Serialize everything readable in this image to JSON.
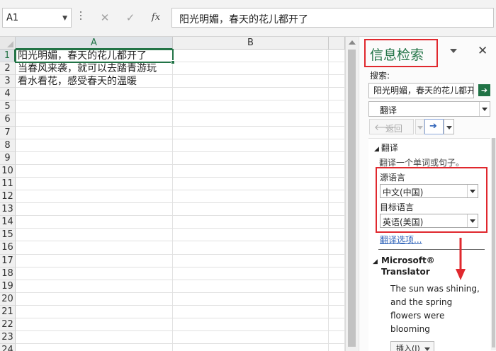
{
  "formula_bar": {
    "name_box": "A1",
    "cancel_icon": "✕",
    "enter_icon": "✓",
    "fx_label": "fx",
    "value": "阳光明媚，春天的花儿都开了"
  },
  "sheet": {
    "columns": [
      "A",
      "B"
    ],
    "rows": [
      {
        "num": "1",
        "a": "阳光明媚，春天的花儿都开了",
        "b": ""
      },
      {
        "num": "2",
        "a": "当春风来袭，就可以去踏青游玩",
        "b": ""
      },
      {
        "num": "3",
        "a": "看水看花，感受春天的温暖",
        "b": ""
      },
      {
        "num": "4",
        "a": "",
        "b": ""
      },
      {
        "num": "5",
        "a": "",
        "b": ""
      },
      {
        "num": "6",
        "a": "",
        "b": ""
      },
      {
        "num": "7",
        "a": "",
        "b": ""
      },
      {
        "num": "8",
        "a": "",
        "b": ""
      },
      {
        "num": "9",
        "a": "",
        "b": ""
      },
      {
        "num": "10",
        "a": "",
        "b": ""
      },
      {
        "num": "11",
        "a": "",
        "b": ""
      },
      {
        "num": "12",
        "a": "",
        "b": ""
      },
      {
        "num": "13",
        "a": "",
        "b": ""
      },
      {
        "num": "14",
        "a": "",
        "b": ""
      },
      {
        "num": "15",
        "a": "",
        "b": ""
      },
      {
        "num": "16",
        "a": "",
        "b": ""
      },
      {
        "num": "17",
        "a": "",
        "b": ""
      },
      {
        "num": "18",
        "a": "",
        "b": ""
      },
      {
        "num": "19",
        "a": "",
        "b": ""
      },
      {
        "num": "20",
        "a": "",
        "b": ""
      },
      {
        "num": "21",
        "a": "",
        "b": ""
      },
      {
        "num": "22",
        "a": "",
        "b": ""
      },
      {
        "num": "23",
        "a": "",
        "b": ""
      },
      {
        "num": "24",
        "a": "",
        "b": ""
      }
    ]
  },
  "pane": {
    "title": "信息检索",
    "close_icon": "✕",
    "search_label": "搜索:",
    "search_value": "阳光明媚，春天的花儿都开了",
    "go_icon": "➔",
    "service": "翻译",
    "back_icon": "🡐",
    "back_label": "返回",
    "forward_icon": "➔",
    "results": {
      "section_title": "翻译",
      "collapse_icon": "◢",
      "description": "翻译一个单词或句子。",
      "source_label": "源语言",
      "source_value": "中文(中国)",
      "target_label": "目标语言",
      "target_value": "英语(美国)",
      "options_link": "翻译选项...",
      "provider_line1": "Microsoft®",
      "provider_line2": "Translator",
      "translation_lines": [
        "The sun was shining,",
        "and the spring",
        "flowers were",
        "blooming"
      ],
      "insert_label": "插入(I)"
    }
  },
  "colors": {
    "excel_green": "#217346",
    "annotation_red": "#e0282e",
    "link_blue": "#2e62b8"
  }
}
